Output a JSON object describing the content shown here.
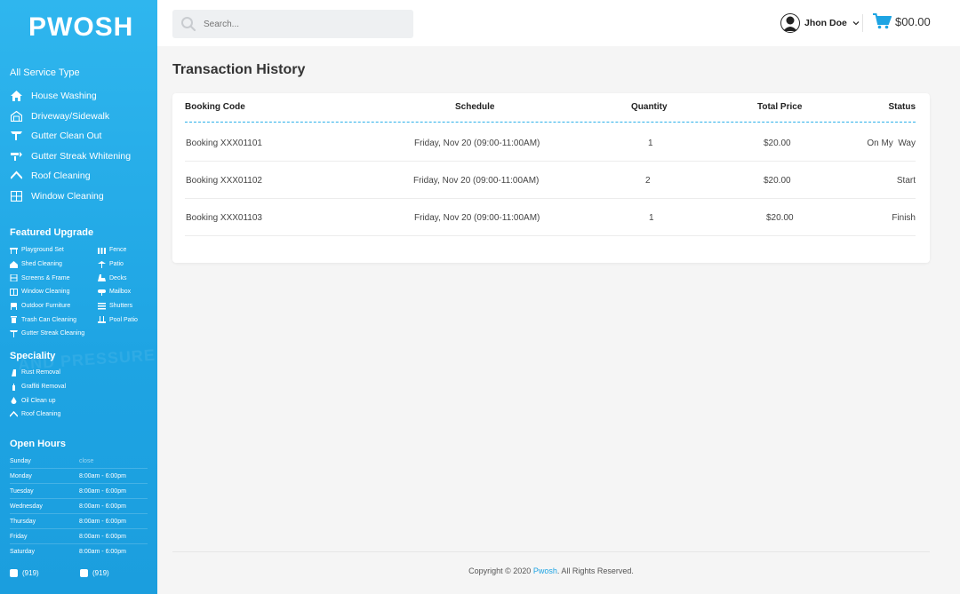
{
  "sidebar": {
    "logo": "PWOSH",
    "service_title": "All Service Type",
    "services": [
      {
        "label": "House Washing",
        "icon": "home-icon"
      },
      {
        "label": "Driveway/Sidewalk",
        "icon": "garage-icon"
      },
      {
        "label": "Gutter Clean Out",
        "icon": "gutter-icon"
      },
      {
        "label": "Gutter Streak Whitening",
        "icon": "gutter-streak-icon"
      },
      {
        "label": "Roof Cleaning",
        "icon": "roof-icon"
      },
      {
        "label": "Window Cleaning",
        "icon": "window-icon"
      }
    ],
    "upgrade_title": "Featured Upgrade",
    "upgrades": [
      "Playground Set",
      "Fence",
      "Shed Cleaning",
      "Patio",
      "Screens & Frame",
      "Decks",
      "Window Cleaning",
      "Mailbox",
      "Outdoor Furniture",
      "Shutters",
      "Trash Can Cleaning",
      "Pool Patio",
      "Gutter Streak Cleaning",
      ""
    ],
    "speciality_title": "Speciality",
    "specialities": [
      "Rust Removal",
      "Graffiti Removal",
      "Oil Clean up",
      "Roof Cleaning"
    ],
    "hours_title": "Open Hours",
    "hours": [
      {
        "day": "Sunday",
        "time": "close"
      },
      {
        "day": "Monday",
        "time": "8:00am - 6:00pm"
      },
      {
        "day": "Tuesday",
        "time": "8:00am - 6:00pm"
      },
      {
        "day": "Wednesday",
        "time": "8:00am - 6:00pm"
      },
      {
        "day": "Thursday",
        "time": "8:00am - 6:00pm"
      },
      {
        "day": "Friday",
        "time": "8:00am - 6:00pm"
      },
      {
        "day": "Saturday",
        "time": "8:00am - 6:00pm"
      }
    ],
    "phones": [
      "(919)",
      "(919)"
    ],
    "background_text": "AND PRESSURE"
  },
  "header": {
    "search_placeholder": "Search...",
    "user_name": "Jhon Doe",
    "cart_total": "$00.00"
  },
  "main": {
    "title": "Transaction History",
    "columns": [
      "Booking Code",
      "Schedule",
      "Quantity",
      "Total Price",
      "Status"
    ],
    "rows": [
      {
        "code": "Booking XXX01101",
        "schedule": "Friday, Nov 20  (09:00-11:00AM)",
        "quantity": "1",
        "price": "$20.00",
        "status": "On My  Way"
      },
      {
        "code": "Booking XXX01102",
        "schedule": "Friday, Nov 20  (09:00-11:00AM)",
        "quantity": "2",
        "price": "$20.00",
        "status": "Start"
      },
      {
        "code": "Booking XXX01103",
        "schedule": "Friday, Nov 20  (09:00-11:00AM)",
        "quantity": "1",
        "price": "$20.00",
        "status": "Finish"
      }
    ]
  },
  "footer": {
    "prefix": "Copyright © 2020 ",
    "brand": "Pwosh",
    "suffix": ". All Rights Reserved."
  },
  "colors": {
    "primary": "#1ea4e3",
    "background": "#f5f5f5"
  }
}
